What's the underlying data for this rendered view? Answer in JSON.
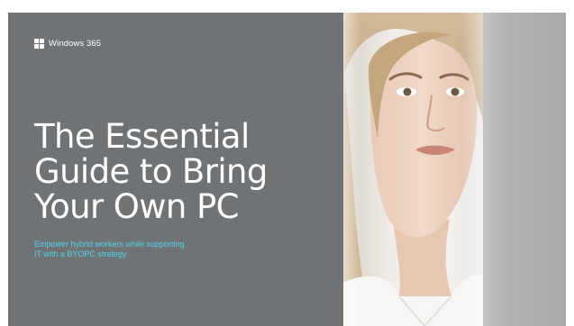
{
  "brand": {
    "logo_icon": "windows-logo-icon",
    "name": "Windows 365"
  },
  "cover": {
    "title_lines": [
      "The Essential",
      "Guide to Bring",
      "Your Own PC"
    ],
    "subtitle_lines": [
      "Empower hybrid workers while supporting",
      "IT with a BYOPC strategy"
    ]
  },
  "colors": {
    "panel_background": "#6f7375",
    "title_text": "#ffffff",
    "subtitle_accent": "#4fd2ea",
    "right_panel": "#b1b2b3"
  },
  "image": {
    "subject": "portrait-photo-icon"
  }
}
